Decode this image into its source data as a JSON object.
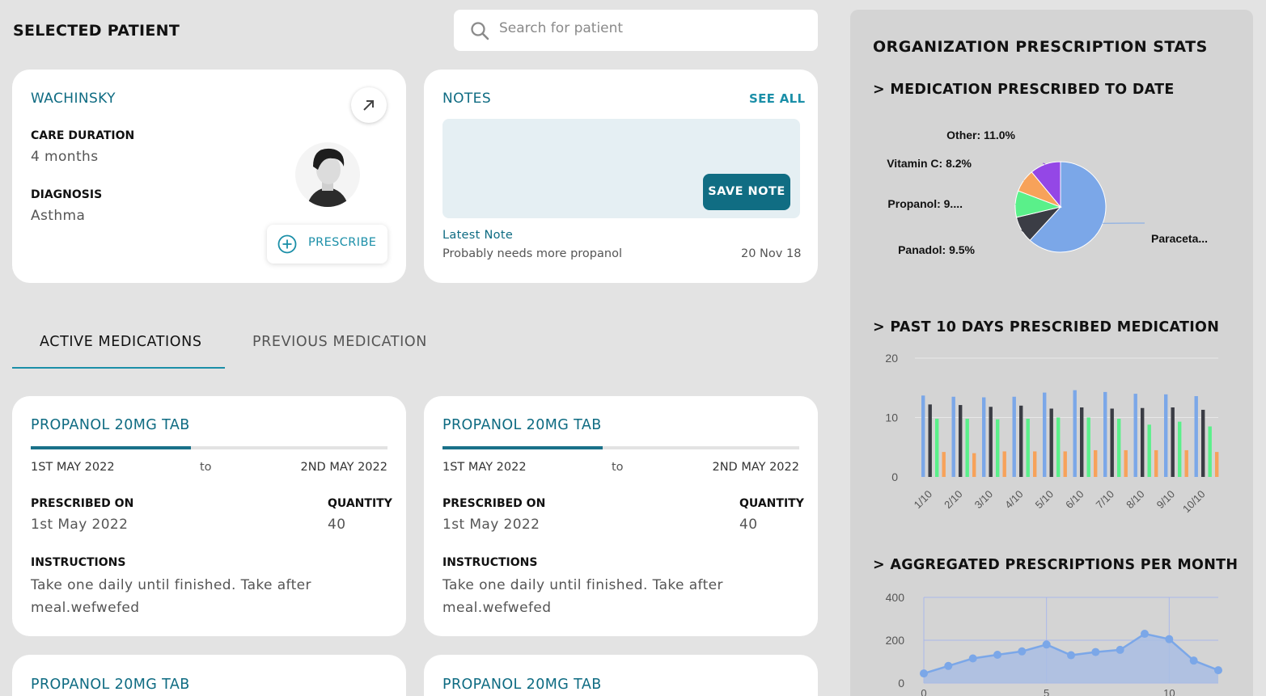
{
  "header": {
    "title": "SELECTED PATIENT",
    "search_placeholder": "Search for patient"
  },
  "patient": {
    "name": "WACHINSKY",
    "care_duration_label": "CARE DURATION",
    "care_duration": "4 months",
    "diagnosis_label": "DIAGNOSIS",
    "diagnosis": "Asthma",
    "prescribe_label": "PRESCRIBE"
  },
  "notes": {
    "title": "NOTES",
    "see_all": "SEE ALL",
    "note_value": "",
    "save_label": "SAVE NOTE",
    "latest_label": "Latest Note",
    "latest_text": "Probably needs more propanol",
    "latest_date": "20 Nov 18"
  },
  "tabs": {
    "active": "ACTIVE MEDICATIONS",
    "previous": "PREVIOUS MEDICATION"
  },
  "medications": [
    {
      "name": "PROPANOL 20MG TAB",
      "progress": 0.45,
      "start": "1ST MAY 2022",
      "to": "to",
      "end": "2ND MAY 2022",
      "prescribed_label": "PRESCRIBED ON",
      "prescribed_on": "1st May 2022",
      "quantity_label": "QUANTITY",
      "quantity": "40",
      "instructions_label": "INSTRUCTIONS",
      "instructions": "Take one daily until finished. Take after meal.wefwefed"
    },
    {
      "name": "PROPANOL 20MG TAB",
      "progress": 0.45,
      "start": "1ST MAY 2022",
      "to": "to",
      "end": "2ND MAY 2022",
      "prescribed_label": "PRESCRIBED ON",
      "prescribed_on": "1st May 2022",
      "quantity_label": "QUANTITY",
      "quantity": "40",
      "instructions_label": "INSTRUCTIONS",
      "instructions": "Take one daily until finished. Take after meal.wefwefed"
    },
    {
      "name": "PROPANOL 20MG TAB"
    },
    {
      "name": "PROPANOL 20MG TAB"
    }
  ],
  "stats": {
    "title": "ORGANIZATION PRESCRIPTION STATS",
    "pie_title": "> MEDICATION PRESCRIBED TO DATE",
    "bar_title": "> PAST 10 DAYS PRESCRIBED MEDICATION",
    "area_title": "> AGGREGATED PRESCRIPTIONS PER MONTH"
  },
  "colors": {
    "teal": "#106d83",
    "blue": "#7ba7e8",
    "dark": "#3b3d45",
    "green": "#5af08a",
    "orange": "#f7a25a",
    "purple": "#9447e6"
  },
  "chart_data": [
    {
      "type": "pie",
      "slices": [
        {
          "label": "Paraceta...",
          "value": 61.8,
          "color": "#7ba7e8"
        },
        {
          "label": "Panadol: 9.5%",
          "value": 9.5,
          "color": "#3b3d45"
        },
        {
          "label": "Propanol: 9....",
          "value": 9.5,
          "color": "#5af08a"
        },
        {
          "label": "Vitamin C: 8.2%",
          "value": 8.2,
          "color": "#f7a25a"
        },
        {
          "label": "Other: 11.0%",
          "value": 11.0,
          "color": "#9447e6"
        }
      ]
    },
    {
      "type": "bar",
      "categories": [
        "1/10",
        "2/10",
        "3/10",
        "4/10",
        "5/10",
        "6/10",
        "7/10",
        "8/10",
        "9/10",
        "10/10"
      ],
      "series": [
        {
          "color": "#7ba7e8",
          "values": [
            13.7,
            13.5,
            13.4,
            13.5,
            14.2,
            14.6,
            14.3,
            14.0,
            13.9,
            13.6
          ]
        },
        {
          "color": "#3b3d45",
          "values": [
            12.2,
            12.1,
            11.8,
            12.0,
            11.5,
            11.7,
            11.5,
            11.6,
            11.7,
            11.3
          ]
        },
        {
          "color": "#5af08a",
          "values": [
            9.8,
            9.8,
            9.7,
            9.8,
            10.0,
            10.0,
            9.8,
            8.8,
            9.3,
            8.5
          ]
        },
        {
          "color": "#f7a25a",
          "values": [
            4.2,
            4.0,
            4.3,
            4.3,
            4.3,
            4.5,
            4.5,
            4.5,
            4.5,
            4.2
          ]
        }
      ],
      "ylim": [
        0,
        20
      ],
      "yticks": [
        0,
        10,
        20
      ],
      "grid": true
    },
    {
      "type": "area",
      "y": [
        45,
        80,
        115,
        132,
        148,
        180,
        130,
        145,
        155,
        230,
        205,
        105,
        60
      ],
      "ylim": [
        0,
        400
      ],
      "yticks": [
        0,
        200,
        400
      ],
      "xticks": [
        "0",
        "5",
        "10"
      ],
      "grid": true
    }
  ]
}
